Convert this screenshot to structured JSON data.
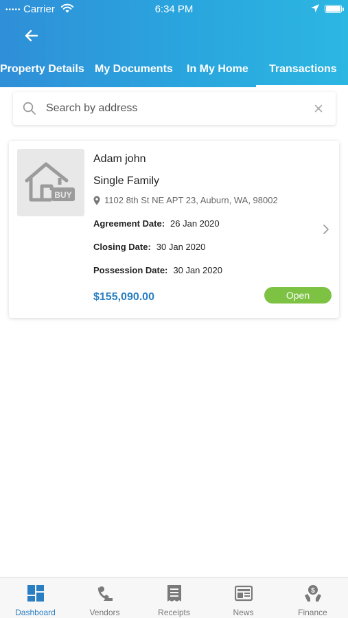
{
  "status_bar": {
    "signal": "•••••",
    "carrier": "Carrier",
    "time": "6:34 PM"
  },
  "header": {
    "back_icon": "arrow-left-icon",
    "tabs": [
      {
        "label": "Property Details",
        "active": false
      },
      {
        "label": "My Documents",
        "active": false
      },
      {
        "label": "In My Home",
        "active": false
      },
      {
        "label": "Transactions",
        "active": true
      }
    ]
  },
  "search": {
    "placeholder": "Search by address",
    "value": ""
  },
  "transaction": {
    "thumb_badge": "BUY",
    "owner": "Adam john",
    "property_type": "Single Family",
    "address": "1102 8th St NE APT 23, Auburn, WA, 98002",
    "agreement_label": "Agreement Date:",
    "agreement_date": "26 Jan 2020",
    "closing_label": "Closing Date:",
    "closing_date": "30 Jan 2020",
    "possession_label": "Possession Date:",
    "possession_date": "30 Jan 2020",
    "price": "$155,090.00",
    "status": "Open"
  },
  "colors": {
    "header_start": "#2f8fd8",
    "header_end": "#2cb6e2",
    "accent": "#2a7fc2",
    "status_open": "#7dc243"
  },
  "bottom_nav": [
    {
      "label": "Dashboard",
      "icon": "dashboard-icon",
      "active": true
    },
    {
      "label": "Vendors",
      "icon": "vendors-icon",
      "active": false
    },
    {
      "label": "Receipts",
      "icon": "receipts-icon",
      "active": false
    },
    {
      "label": "News",
      "icon": "news-icon",
      "active": false
    },
    {
      "label": "Finance",
      "icon": "finance-icon",
      "active": false
    }
  ]
}
